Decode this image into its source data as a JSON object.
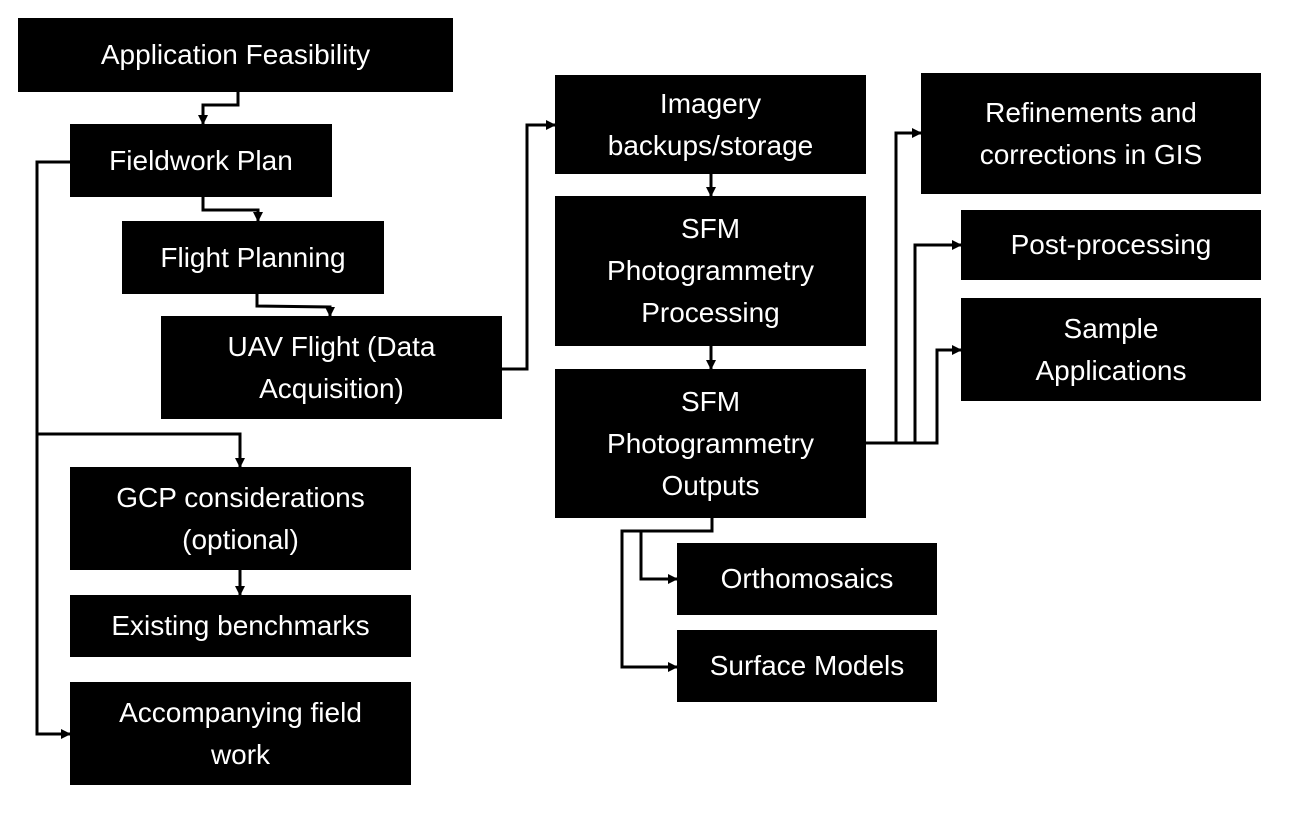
{
  "nodes": {
    "application_feasibility": "Application Feasibility",
    "fieldwork_plan": "Fieldwork Plan",
    "flight_planning": "Flight Planning",
    "uav_flight": "UAV Flight (Data Acquisition)",
    "gcp_considerations": "GCP considerations (optional)",
    "existing_benchmarks": "Existing benchmarks",
    "accompanying_field_work": "Accompanying field work",
    "imagery_backups": "Imagery backups/storage",
    "sfm_processing": "SFM Photogrammetry Processing",
    "sfm_outputs": "SFM Photogrammetry Outputs",
    "refinements": "Refinements and corrections in GIS",
    "post_processing": "Post-processing",
    "sample_applications": "Sample Applications",
    "orthomosaics": "Orthomosaics",
    "surface_models": "Surface Models"
  },
  "colors": {
    "box": "#000000",
    "text": "#ffffff",
    "connector": "#000000",
    "background": "#ffffff"
  }
}
